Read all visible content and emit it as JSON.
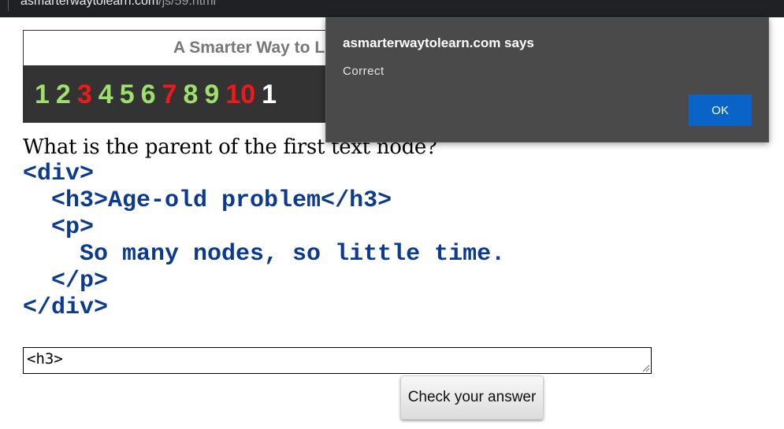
{
  "browser": {
    "url_host": "asmarterwaytolearn.com",
    "url_path": "/js/59.html"
  },
  "banner": {
    "title": "A Smarter Way to L",
    "numbers": [
      {
        "text": "1",
        "color": "#9ee06c"
      },
      {
        "text": "2",
        "color": "#9ee06c"
      },
      {
        "text": "3",
        "color": "#f01818"
      },
      {
        "text": "4",
        "color": "#9ee06c"
      },
      {
        "text": "5",
        "color": "#9ee06c"
      },
      {
        "text": "6",
        "color": "#9ee06c"
      },
      {
        "text": "7",
        "color": "#f01818"
      },
      {
        "text": "8",
        "color": "#9ee06c"
      },
      {
        "text": "9",
        "color": "#9ee06c"
      },
      {
        "text": "10",
        "color": "#f01818"
      },
      {
        "text": "1",
        "color": "#ffffff"
      }
    ]
  },
  "question": {
    "text": "What is the parent of the first text node?",
    "code": "<div>\n  <h3>Age-old problem</h3>\n  <p>\n    So many nodes, so little time.\n  </p>\n</div>"
  },
  "answer": {
    "value": "<h3>"
  },
  "check_button": {
    "label": "Check your answer"
  },
  "dialog": {
    "title": "asmarterwaytolearn.com says",
    "message": "Correct",
    "ok_label": "OK"
  },
  "colors": {
    "code_blue": "#0b3a8e",
    "dialog_bg": "#4a4a4a",
    "ok_blue": "#0a64c8"
  }
}
